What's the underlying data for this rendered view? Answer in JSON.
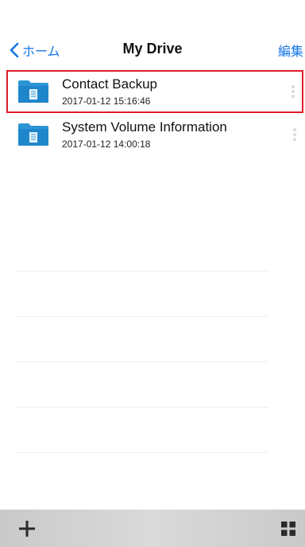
{
  "nav": {
    "back_label": "ホーム",
    "title": "My Drive",
    "edit_label": "編集"
  },
  "files": [
    {
      "name": "Contact Backup",
      "date": "2017-01-12 15:16:46",
      "selected": true
    },
    {
      "name": "System Volume Information",
      "date": "2017-01-12 14:00:18",
      "selected": false
    }
  ],
  "toolbar": {
    "add_icon": "plus-icon",
    "view_icon": "grid-view-icon"
  },
  "colors": {
    "accent": "#1676e8",
    "folder": "#2b95d6",
    "selection": "#e21b2a"
  }
}
